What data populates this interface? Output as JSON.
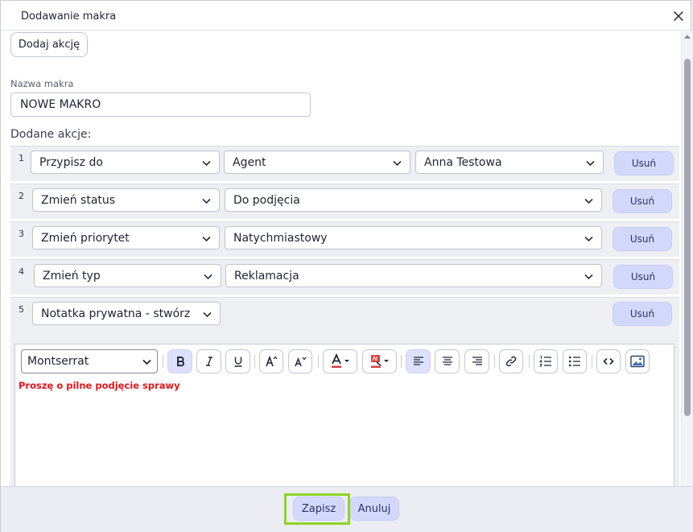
{
  "dialog": {
    "title": "Dodawanie makra"
  },
  "toolbar": {
    "add_action_label": "Dodaj akcję"
  },
  "macro_name": {
    "label": "Nazwa makra",
    "value": "NOWE MAKRO"
  },
  "actions_section": {
    "label": "Dodane akcje:",
    "remove_label": "Usuń",
    "rows": [
      {
        "number": "1",
        "action": "Przypisz do",
        "param1": "Agent",
        "param2": "Anna Testowa"
      },
      {
        "number": "2",
        "action": "Zmień status",
        "param1": "Do podjęcia"
      },
      {
        "number": "3",
        "action": "Zmień priorytet",
        "param1": "Natychmiastowy"
      },
      {
        "number": "4",
        "action": "Zmień typ",
        "param1": "Reklamacja"
      },
      {
        "number": "5",
        "action": "Notatka prywatna - stwórz"
      }
    ]
  },
  "editor": {
    "font": "Montserrat",
    "content": "Proszę o pilne podjęcie sprawy",
    "content_color": "#e4151b"
  },
  "footer": {
    "save_label": "Zapisz",
    "cancel_label": "Anuluj"
  },
  "colors": {
    "accent_soft": "#d3d8fb",
    "highlight": "#8fd324"
  }
}
